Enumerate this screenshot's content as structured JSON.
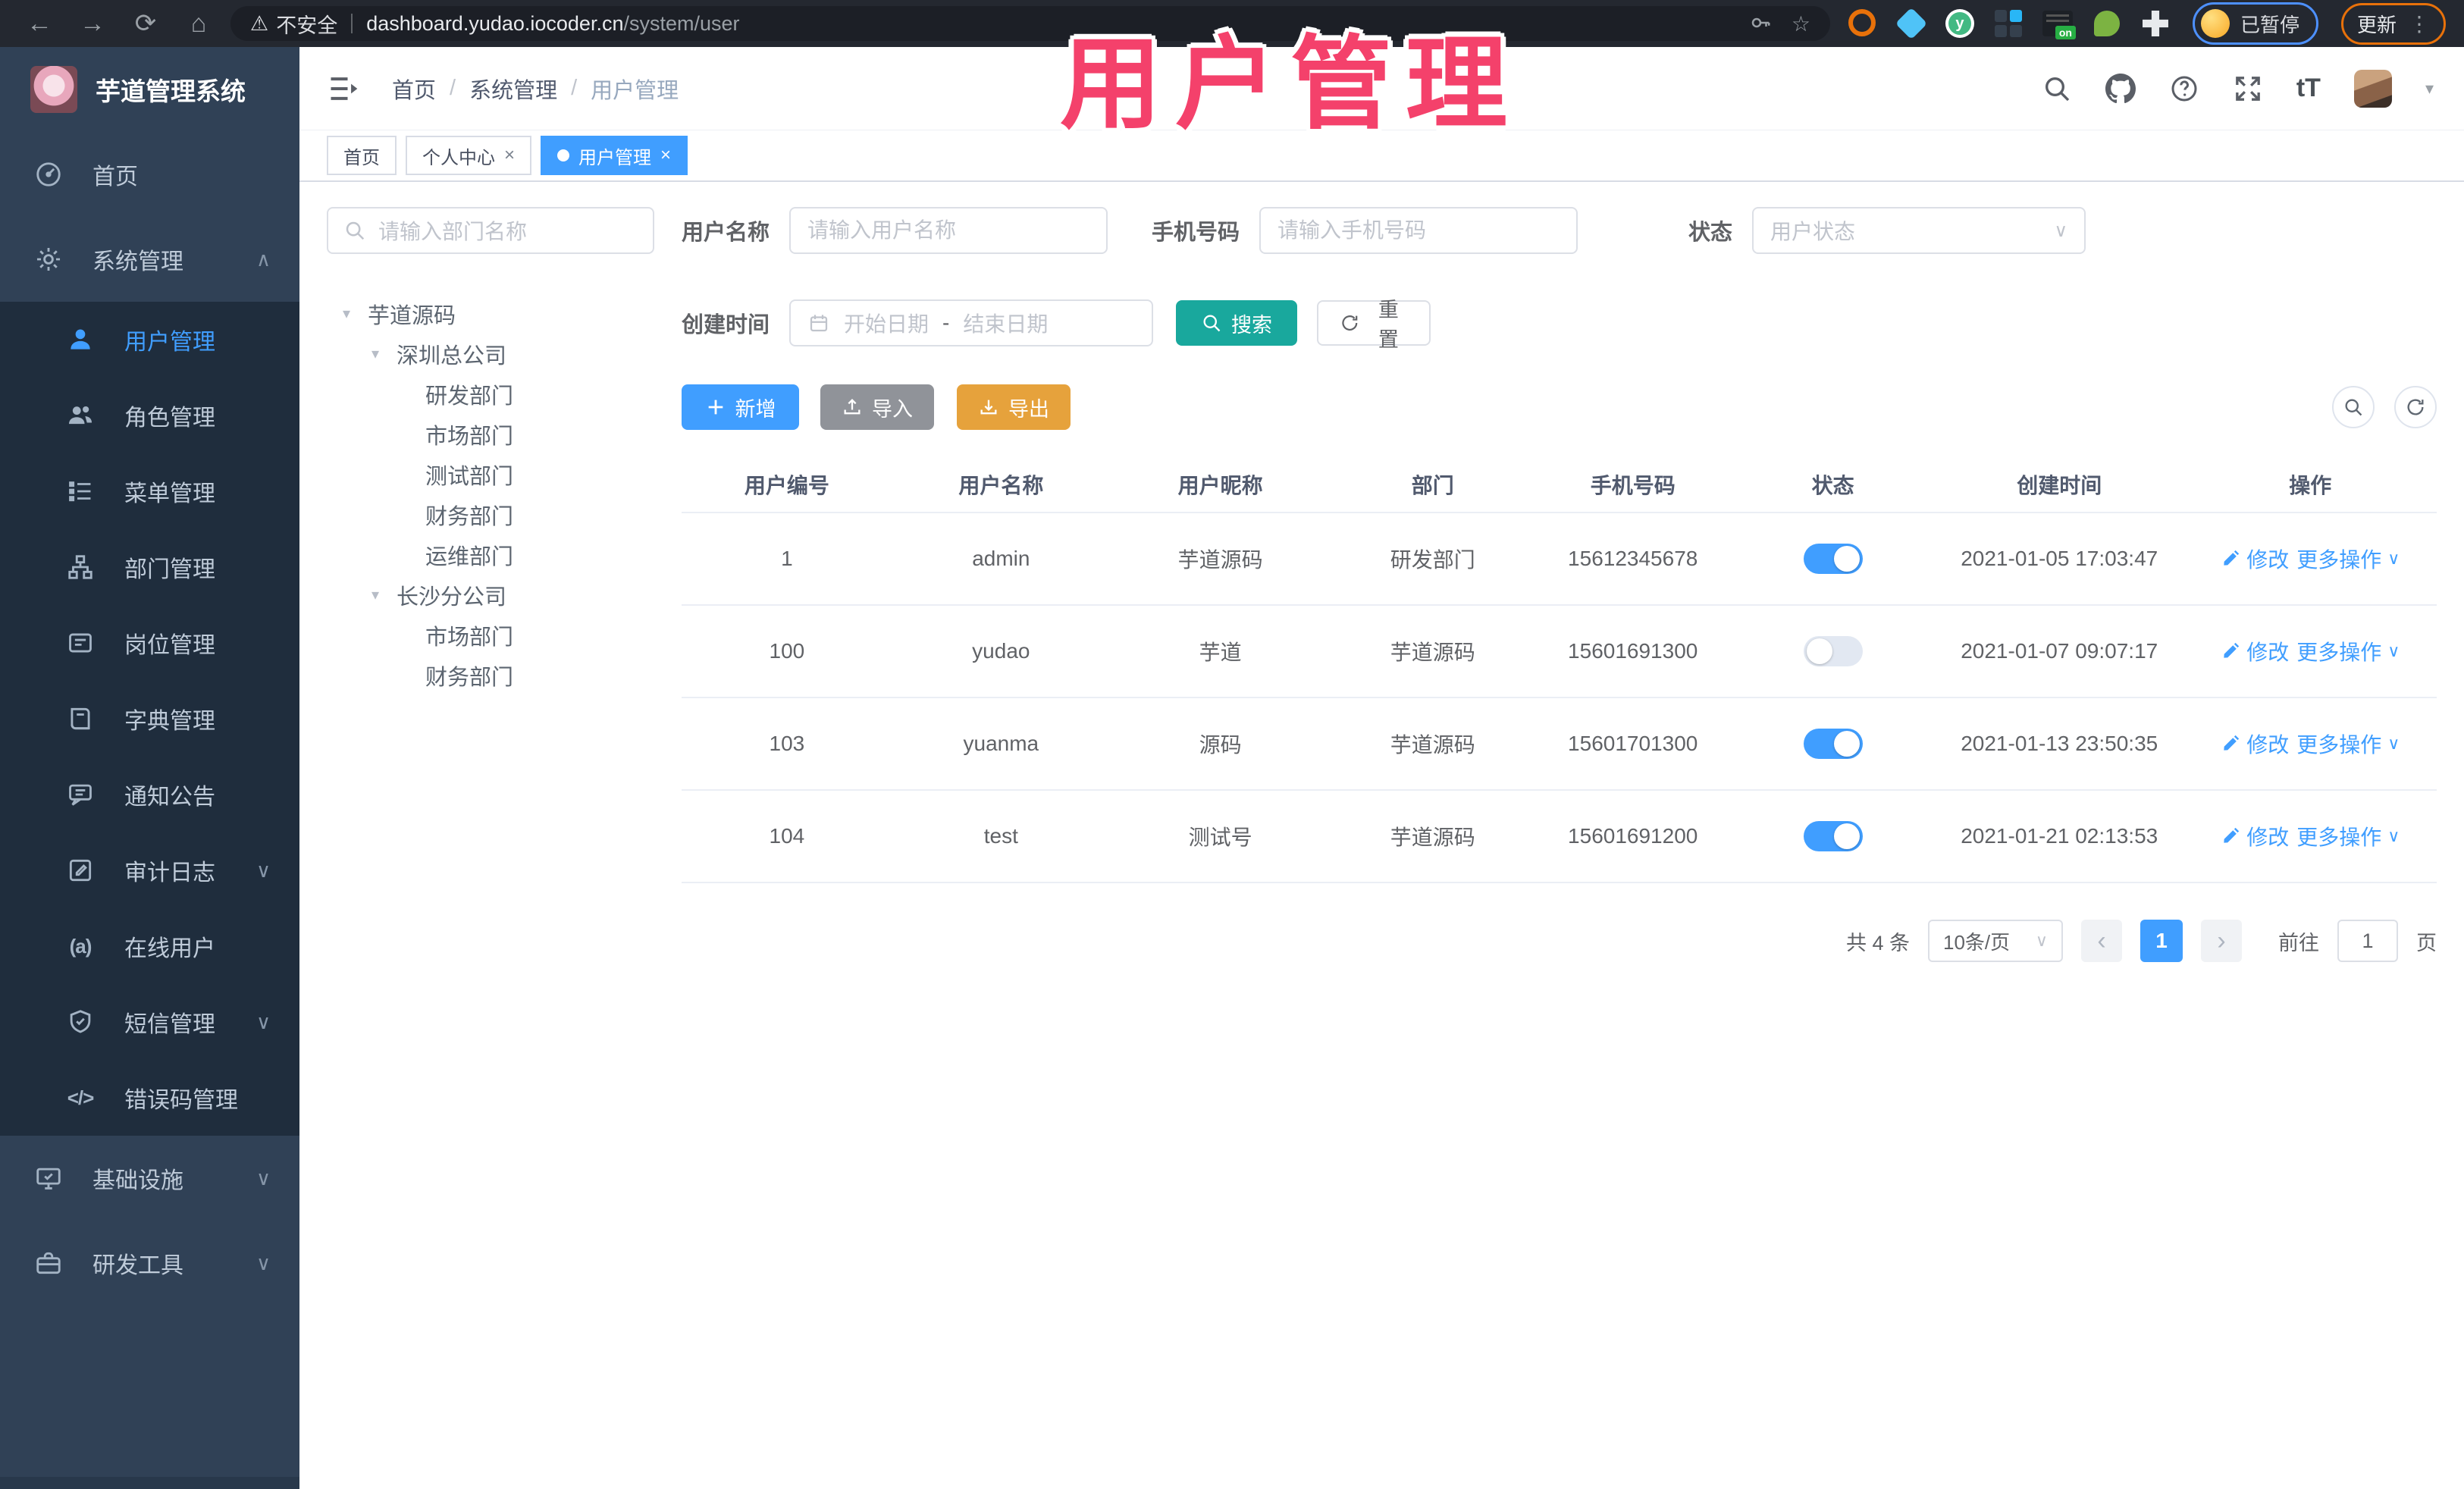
{
  "browser": {
    "security_label": "不安全",
    "url_host": "dashboard.yudao.iocoder.cn",
    "url_path": "/system/user",
    "extension_on_badge": "on",
    "profile_status": "已暂停",
    "update_label": "更新"
  },
  "icons": {
    "back": "←",
    "forward": "→",
    "reload": "⟳",
    "home": "⌂",
    "warning": "⚠",
    "star": "☆",
    "kebab": "⋮",
    "close": "×",
    "caret_up": "∧",
    "caret_down": "∨",
    "tree_caret": "▾",
    "online": "(a)",
    "code": "</>",
    "font_size": "tT",
    "prev": "‹",
    "next": "›",
    "hdr_caret": "▾",
    "vue": "y"
  },
  "app": {
    "title": "芋道管理系统",
    "watermark": "用户管理"
  },
  "sidebar": {
    "items": [
      {
        "label": "首页"
      },
      {
        "label": "系统管理"
      },
      {
        "label": "用户管理"
      },
      {
        "label": "角色管理"
      },
      {
        "label": "菜单管理"
      },
      {
        "label": "部门管理"
      },
      {
        "label": "岗位管理"
      },
      {
        "label": "字典管理"
      },
      {
        "label": "通知公告"
      },
      {
        "label": "审计日志"
      },
      {
        "label": "在线用户"
      },
      {
        "label": "短信管理"
      },
      {
        "label": "错误码管理"
      },
      {
        "label": "基础设施"
      },
      {
        "label": "研发工具"
      }
    ]
  },
  "header": {
    "breadcrumb": [
      "首页",
      "系统管理",
      "用户管理"
    ],
    "separator": "/"
  },
  "tabs": [
    {
      "label": "首页"
    },
    {
      "label": "个人中心"
    },
    {
      "label": "用户管理"
    }
  ],
  "tree": {
    "search_placeholder": "请输入部门名称",
    "nodes": [
      {
        "label": "芋道源码"
      },
      {
        "label": "深圳总公司"
      },
      {
        "label": "研发部门"
      },
      {
        "label": "市场部门"
      },
      {
        "label": "测试部门"
      },
      {
        "label": "财务部门"
      },
      {
        "label": "运维部门"
      },
      {
        "label": "长沙分公司"
      },
      {
        "label": "市场部门"
      },
      {
        "label": "财务部门"
      }
    ]
  },
  "filters": {
    "username_label": "用户名称",
    "username_placeholder": "请输入用户名称",
    "mobile_label": "手机号码",
    "mobile_placeholder": "请输入手机号码",
    "status_label": "状态",
    "status_placeholder": "用户状态",
    "created_label": "创建时间",
    "date_start_placeholder": "开始日期",
    "date_separator": "-",
    "date_end_placeholder": "结束日期",
    "search_button": "搜索",
    "reset_button": "重置"
  },
  "toolbar": {
    "add_label": "新增",
    "import_label": "导入",
    "export_label": "导出"
  },
  "table": {
    "headers": [
      "用户编号",
      "用户名称",
      "用户昵称",
      "部门",
      "手机号码",
      "状态",
      "创建时间",
      "操作"
    ],
    "edit_label": "修改",
    "more_label": "更多操作",
    "rows": [
      {
        "id": "1",
        "username": "admin",
        "nickname": "芋道源码",
        "dept": "研发部门",
        "mobile": "15612345678",
        "status": true,
        "created": "2021-01-05 17:03:47"
      },
      {
        "id": "100",
        "username": "yudao",
        "nickname": "芋道",
        "dept": "芋道源码",
        "mobile": "15601691300",
        "status": false,
        "created": "2021-01-07 09:07:17"
      },
      {
        "id": "103",
        "username": "yuanma",
        "nickname": "源码",
        "dept": "芋道源码",
        "mobile": "15601701300",
        "status": true,
        "created": "2021-01-13 23:50:35"
      },
      {
        "id": "104",
        "username": "test",
        "nickname": "测试号",
        "dept": "芋道源码",
        "mobile": "15601691200",
        "status": true,
        "created": "2021-01-21 02:13:53"
      }
    ]
  },
  "pagination": {
    "total_text": "共 4 条",
    "page_size": "10条/页",
    "current_page": "1",
    "goto_label": "前往",
    "goto_value": "1",
    "page_label": "页"
  }
}
